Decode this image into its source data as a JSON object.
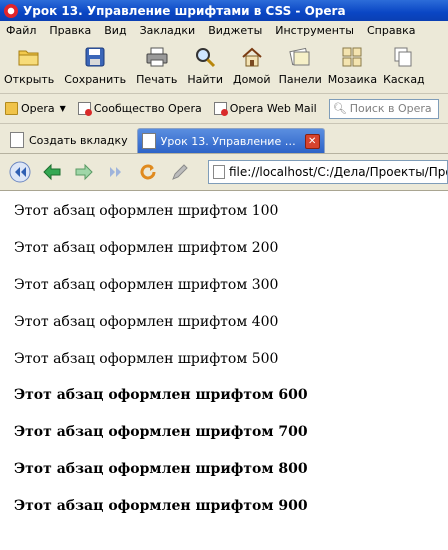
{
  "window": {
    "title": "Урок 13. Управление шрифтами в CSS - Opera"
  },
  "menu": [
    "Файл",
    "Правка",
    "Вид",
    "Закладки",
    "Виджеты",
    "Инструменты",
    "Справка"
  ],
  "toolbar": {
    "open": "Открыть",
    "save": "Сохранить",
    "print": "Печать",
    "find": "Найти",
    "home": "Домой",
    "panels": "Панели",
    "tile": "Мозаика",
    "cascade": "Каскад"
  },
  "personal_bar": {
    "opera": "Opera",
    "community": "Сообщество Opera",
    "webmail": "Opera Web Mail",
    "search_placeholder": "Поиск в Opera"
  },
  "tabs": {
    "new_tab": "Создать вкладку",
    "active": "Урок 13. Управление ш..."
  },
  "address": {
    "url": "file://localhost/C:/Дела/Проекты/Програ"
  },
  "paragraphs": [
    {
      "text": "Этот абзац оформлен шрифтом 100",
      "weight": 100
    },
    {
      "text": "Этот абзац оформлен шрифтом 200",
      "weight": 200
    },
    {
      "text": "Этот абзац оформлен шрифтом 300",
      "weight": 300
    },
    {
      "text": "Этот абзац оформлен шрифтом 400",
      "weight": 400
    },
    {
      "text": "Этот абзац оформлен шрифтом 500",
      "weight": 500
    },
    {
      "text": "Этот абзац оформлен шрифтом 600",
      "weight": 600
    },
    {
      "text": "Этот абзац оформлен шрифтом 700",
      "weight": 700
    },
    {
      "text": "Этот абзац оформлен шрифтом 800",
      "weight": 800
    },
    {
      "text": "Этот абзац оформлен шрифтом 900",
      "weight": 900
    }
  ]
}
